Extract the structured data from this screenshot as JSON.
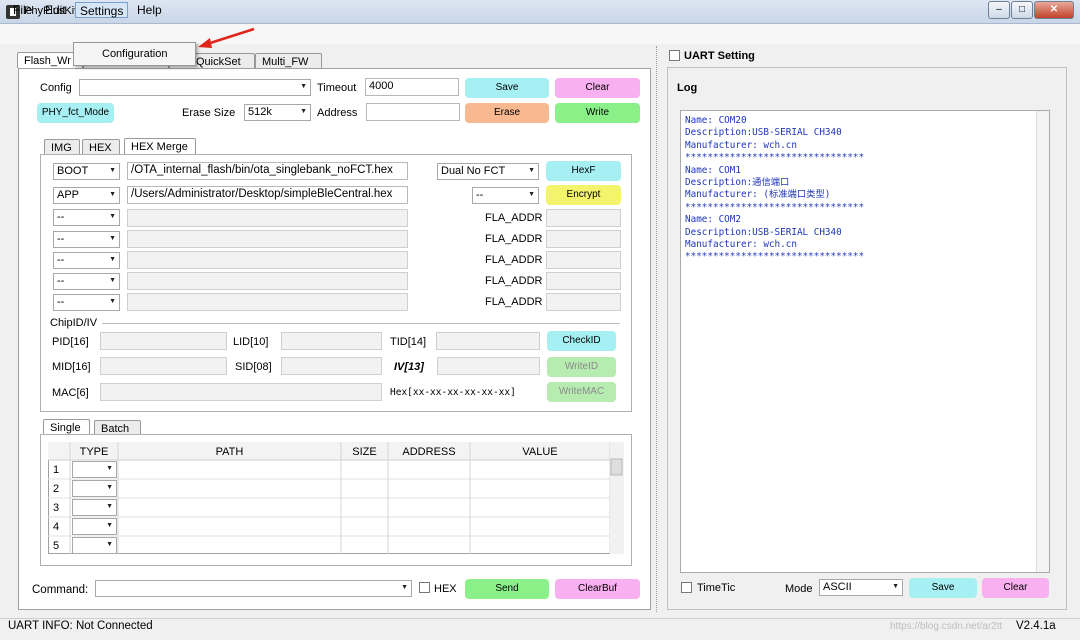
{
  "window": {
    "title": "PhyPlusKit",
    "min": "–",
    "max": "□",
    "close": "✕"
  },
  "menu": {
    "file": "File",
    "edit": "Edit",
    "settings": "Settings",
    "help": "Help",
    "settings_items": [
      "Configuration"
    ]
  },
  "tabs": [
    "Flash_Wr",
    "",
    "QuickSet",
    "Multi_FW"
  ],
  "flash": {
    "config_label": "Config",
    "config_value": "",
    "timeout_label": "Timeout",
    "timeout_value": "4000",
    "save": "Save",
    "clear": "Clear",
    "mode_button": "PHY_fct_Mode",
    "erase_size_label": "Erase Size",
    "erase_size_value": "512k",
    "address_label": "Address",
    "address_value": "",
    "erase": "Erase",
    "write": "Write"
  },
  "subtabs": [
    "IMG",
    "HEX",
    "HEX Merge"
  ],
  "hexmerge": {
    "rows": [
      {
        "type": "BOOT",
        "path": "/OTA_internal_flash/bin/ota_singlebank_noFCT.hex"
      },
      {
        "type": "APP",
        "path": "/Users/Administrator/Desktop/simpleBleCentral.hex"
      },
      {
        "type": "--",
        "path": ""
      },
      {
        "type": "--",
        "path": ""
      },
      {
        "type": "--",
        "path": ""
      },
      {
        "type": "--",
        "path": ""
      },
      {
        "type": "--",
        "path": ""
      }
    ],
    "fct_value": "Dual No FCT",
    "hexf": "HexF",
    "enc_value": "--",
    "encrypt": "Encrypt",
    "fla_addr": "FLA_ADDR"
  },
  "chipid": {
    "title": "ChipID/IV",
    "pid": "PID[16]",
    "lid": "LID[10]",
    "tid": "TID[14]",
    "checkid": "CheckID",
    "mid": "MID[16]",
    "sid": "SID[08]",
    "iv": "IV[13]",
    "writeid": "WriteID",
    "mac": "MAC[6]",
    "hexfmt": "Hex[xx-xx-xx-xx-xx-xx]",
    "writemac": "WriteMAC"
  },
  "single_tabs": [
    "Single",
    "Batch"
  ],
  "table": {
    "headers": [
      "TYPE",
      "PATH",
      "SIZE",
      "ADDRESS",
      "VALUE"
    ],
    "rows": [
      "1",
      "2",
      "3",
      "4",
      "5"
    ]
  },
  "command": {
    "label": "Command:",
    "value": "",
    "hex": "HEX",
    "send": "Send",
    "clearbuf": "ClearBuf"
  },
  "uart": {
    "setting": "UART Setting"
  },
  "log": {
    "title": "Log",
    "text": "Name: COM20\nDescription:USB-SERIAL CH340\nManufacturer: wch.cn\n********************************\nName: COM1\nDescription:通信端口\nManufacturer: (标准端口类型)\n********************************\nName: COM2\nDescription:USB-SERIAL CH340\nManufacturer: wch.cn\n********************************"
  },
  "bottom_right": {
    "timetic": "TimeTic",
    "mode_label": "Mode",
    "mode_value": "ASCII",
    "save": "Save",
    "clear": "Clear"
  },
  "status": {
    "text": "UART INFO: Not Connected",
    "version": "V2.4.1a",
    "watermark": "https://blog.csdn.net/ar2tt"
  },
  "colors": {
    "cyan": "#a6f0f4",
    "pink": "#f8b0f0",
    "orange": "#f8b890",
    "green": "#8cf088",
    "yellow": "#f4f46c",
    "log_text": "#1f36b8"
  }
}
